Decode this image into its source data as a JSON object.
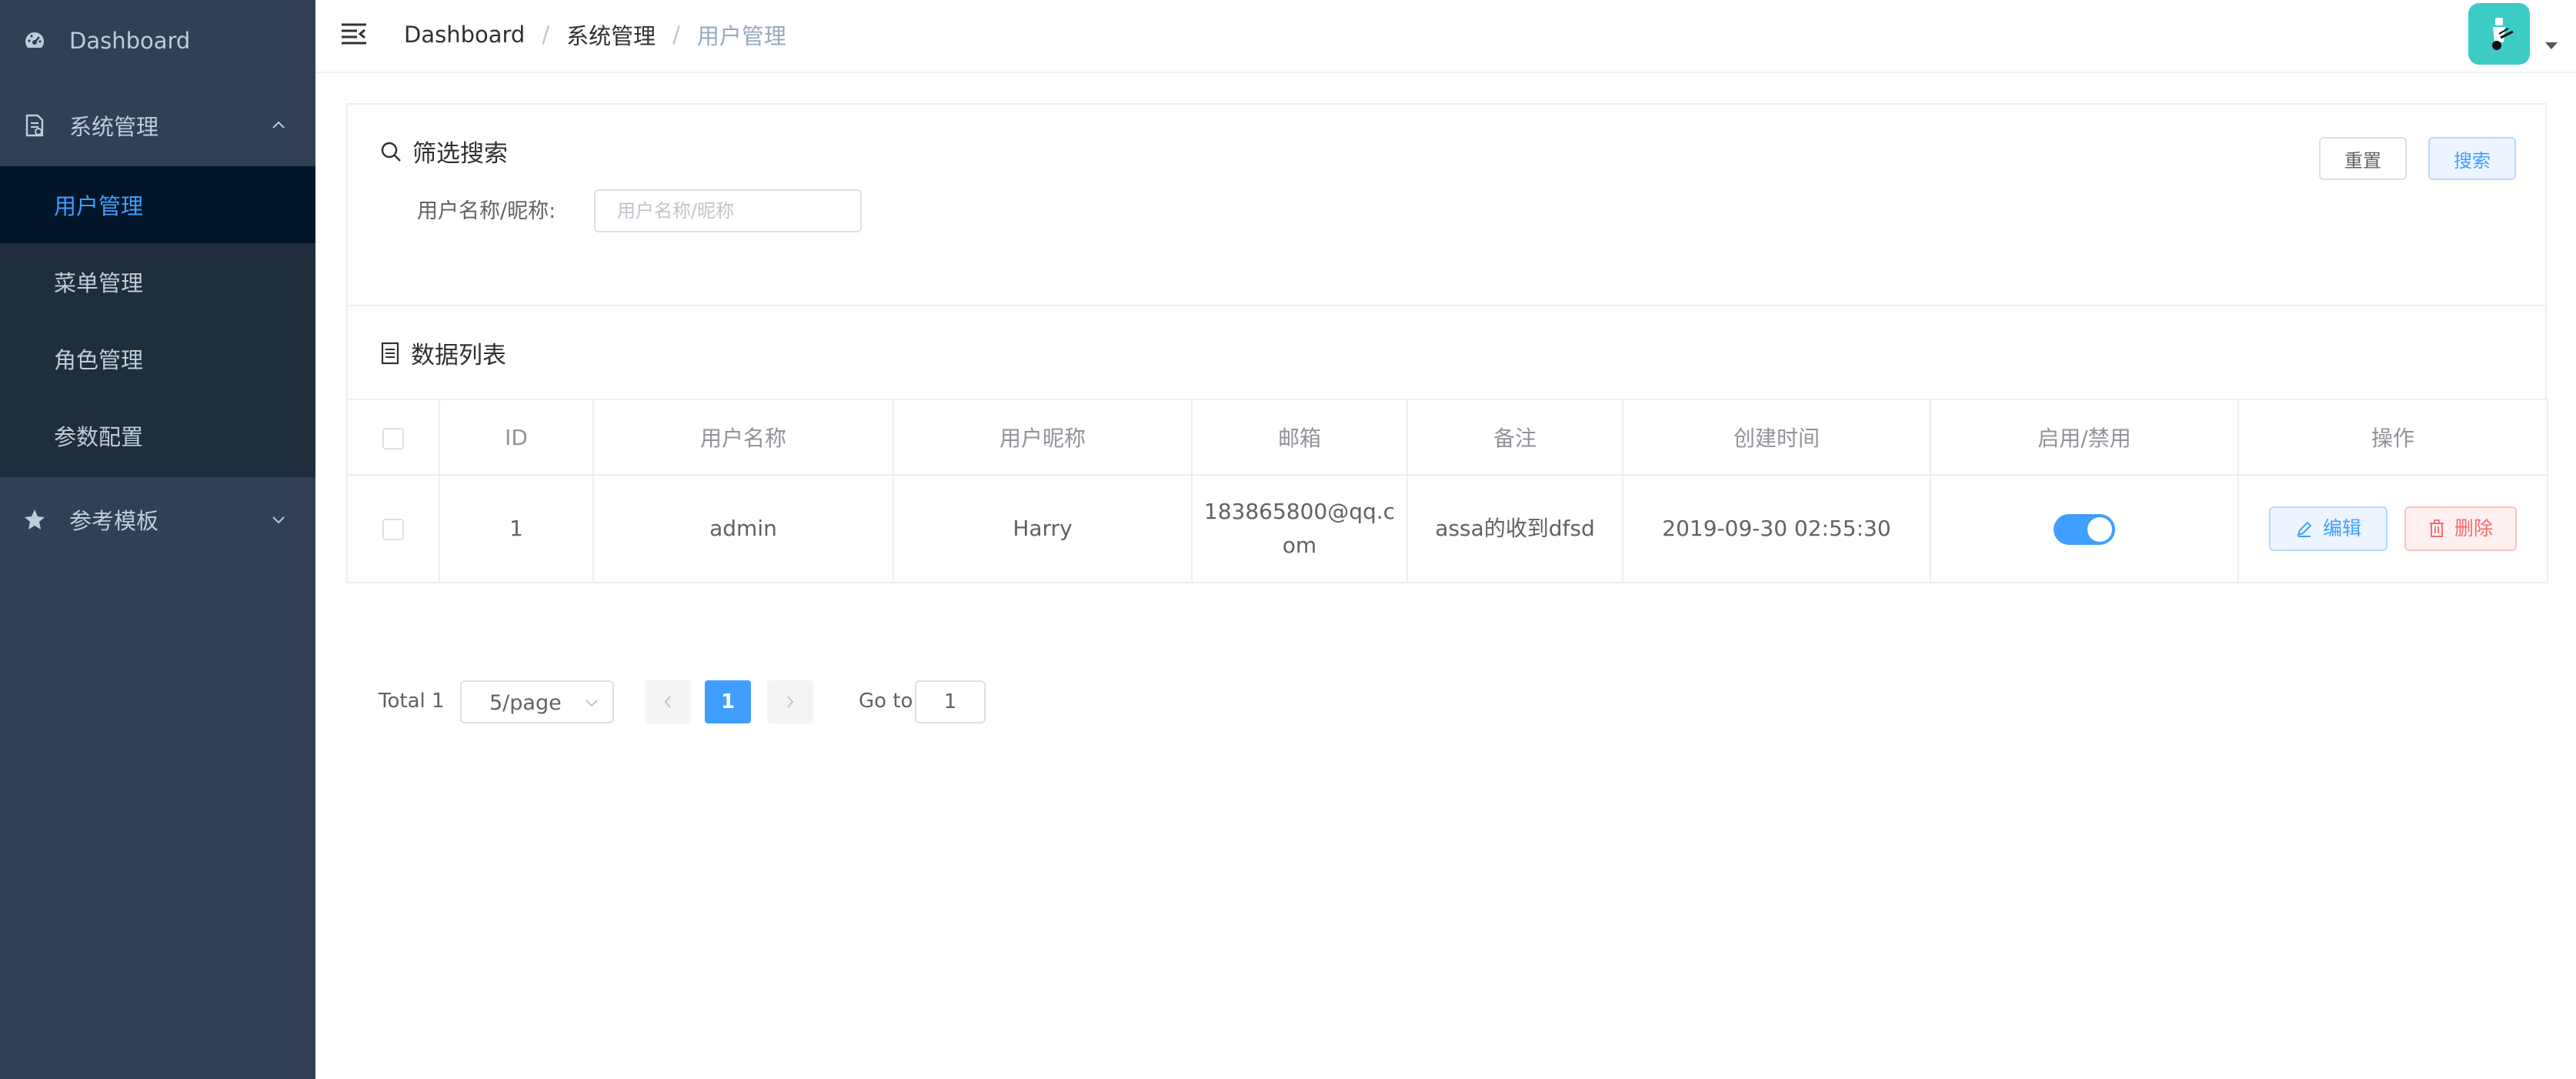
{
  "sidebar": {
    "items": [
      {
        "label": "Dashboard",
        "icon": "dashboard-icon"
      },
      {
        "label": "系统管理",
        "icon": "document-icon",
        "expanded": true
      },
      {
        "label": "参考模板",
        "icon": "star-icon",
        "expanded": false
      }
    ],
    "submenu": [
      {
        "label": "用户管理",
        "active": true
      },
      {
        "label": "菜单管理"
      },
      {
        "label": "角色管理"
      },
      {
        "label": "参数配置"
      }
    ]
  },
  "breadcrumb": [
    "Dashboard",
    "系统管理",
    "用户管理"
  ],
  "breadcrumb_separator": "/",
  "filter": {
    "title": "筛选搜索",
    "label": "用户名称/昵称:",
    "placeholder": "用户名称/昵称",
    "value": "",
    "reset_label": "重置",
    "search_label": "搜索"
  },
  "list": {
    "title": "数据列表",
    "columns": [
      "ID",
      "用户名称",
      "用户昵称",
      "邮箱",
      "备注",
      "创建时间",
      "启用/禁用",
      "操作"
    ],
    "rows": [
      {
        "id": "1",
        "username": "admin",
        "nickname": "Harry",
        "email": "183865800@qq.com",
        "remark": "assa的收到dfsd",
        "created": "2019-09-30 02:55:30",
        "enabled": true
      }
    ],
    "edit_label": "编辑",
    "delete_label": "删除"
  },
  "pagination": {
    "total_label": "Total 1",
    "page_size": "5/page",
    "current_page": "1",
    "goto_label": "Go to",
    "goto_value": "1"
  },
  "colors": {
    "sidebar_bg": "#304156",
    "submenu_bg": "#1f2d3d",
    "active_bg": "#001528",
    "primary": "#409eff",
    "danger": "#f56c6c",
    "avatar": "#3dcbc6"
  }
}
